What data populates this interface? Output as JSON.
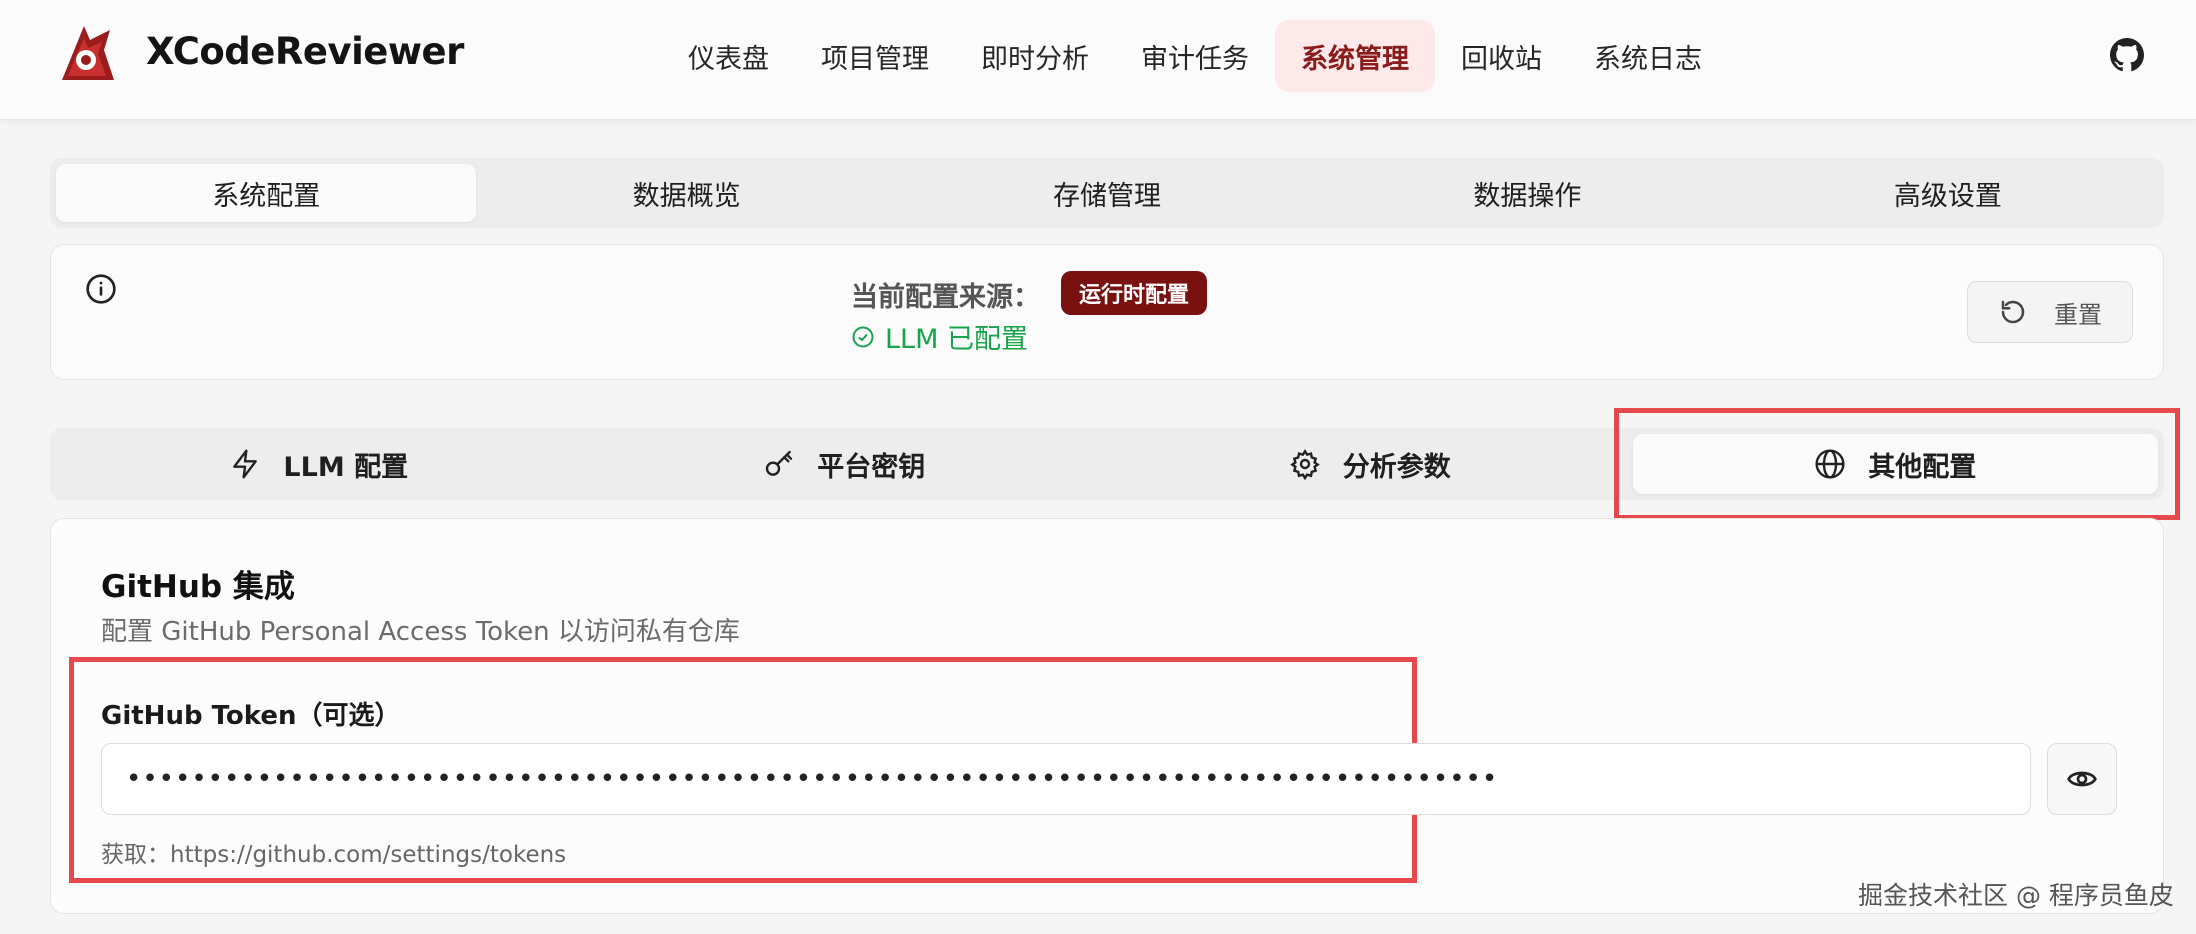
{
  "app": {
    "name": "XCodeReviewer"
  },
  "nav": {
    "items": [
      {
        "label": "仪表盘"
      },
      {
        "label": "项目管理"
      },
      {
        "label": "即时分析"
      },
      {
        "label": "审计任务"
      },
      {
        "label": "系统管理"
      },
      {
        "label": "回收站"
      },
      {
        "label": "系统日志"
      }
    ],
    "active": "系统管理"
  },
  "system_tabs": {
    "items": [
      {
        "label": "系统配置"
      },
      {
        "label": "数据概览"
      },
      {
        "label": "存储管理"
      },
      {
        "label": "数据操作"
      },
      {
        "label": "高级设置"
      }
    ],
    "active": "系统配置"
  },
  "config_source": {
    "label": "当前配置来源：",
    "badge": "运行时配置",
    "llm_status": "LLM 已配置",
    "reset_label": "重置"
  },
  "config_tabs": {
    "items": [
      {
        "label": "LLM 配置",
        "icon": "zap-icon"
      },
      {
        "label": "平台密钥",
        "icon": "key-icon"
      },
      {
        "label": "分析参数",
        "icon": "gear-icon"
      },
      {
        "label": "其他配置",
        "icon": "globe-icon"
      }
    ],
    "active": "其他配置"
  },
  "github": {
    "title": "GitHub 集成",
    "description": "配置 GitHub Personal Access Token 以访问私有仓库",
    "token_label": "GitHub Token（可选）",
    "token_value": "••••••••••••••••••••••••••••••••••••••••••••••••••••••••••••••••••••••••••••••••••••",
    "help": "获取：https://github.com/settings/tokens"
  },
  "watermark": "掘金技术社区 @ 程序员鱼皮",
  "colors": {
    "accent": "#7a1111",
    "success": "#16a34a",
    "highlight": "#e5484d",
    "active_nav_bg": "#fde9e9"
  }
}
